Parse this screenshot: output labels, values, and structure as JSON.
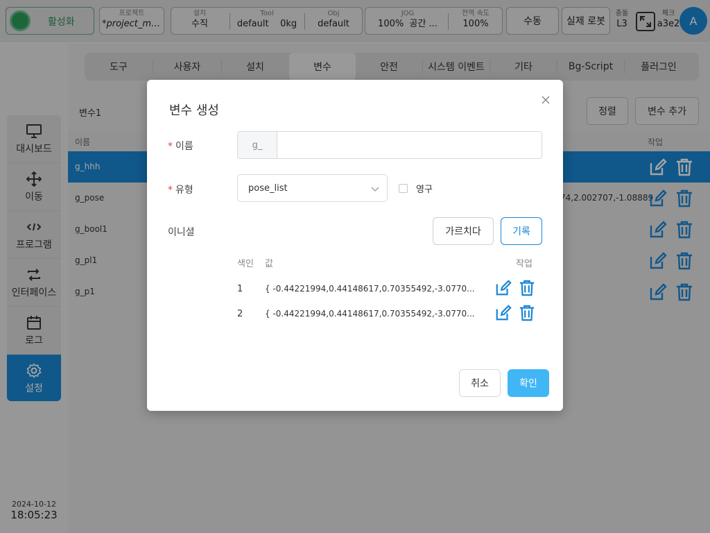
{
  "topbar": {
    "activate_label": "활성화",
    "project": {
      "label": "프로젝트",
      "value": "*project_mo..."
    },
    "install": {
      "label": "설치",
      "value": "수직"
    },
    "tool": {
      "label": "Tool",
      "value1": "default",
      "value2": "0kg"
    },
    "obj": {
      "label": "Obj",
      "value": "default"
    },
    "jog": {
      "label": "JOG",
      "value1": "100%",
      "value2": "공간 ..."
    },
    "speed": {
      "label": "전역 속도",
      "value": "100%"
    },
    "manual_label": "수동",
    "real_robot_label": "실제 로봇",
    "collision": {
      "label": "충돌",
      "value": "L3"
    },
    "check": {
      "label": "체크",
      "value": "a3e2"
    },
    "avatar_letter": "A"
  },
  "sidebar": {
    "items": [
      {
        "label": "대시보드",
        "icon": "monitor-icon"
      },
      {
        "label": "이동",
        "icon": "move-icon"
      },
      {
        "label": "프로그램",
        "icon": "code-icon"
      },
      {
        "label": "인터페이스",
        "icon": "swap-icon"
      },
      {
        "label": "로그",
        "icon": "calendar-icon"
      },
      {
        "label": "설정",
        "icon": "gear-icon"
      }
    ],
    "active_index": 5,
    "date": "2024-10-12",
    "time": "18:05:23"
  },
  "tabs": [
    "도구",
    "사용자",
    "설치",
    "변수",
    "안전",
    "시스템 이벤트",
    "기타",
    "Bg-Script",
    "플러그인"
  ],
  "active_tab": "변수",
  "varbar": {
    "title": "변수1",
    "sort_label": "정렬",
    "add_label": "변수 추가"
  },
  "table": {
    "headers": {
      "name": "이름",
      "action": "작업"
    },
    "rows": [
      {
        "name": "g_hhh",
        "value": "",
        "selected": true
      },
      {
        "name": "g_pose",
        "value": "74,2.002707,-1.08889",
        "selected": false
      },
      {
        "name": "g_bool1",
        "value": "",
        "selected": false
      },
      {
        "name": "g_pl1",
        "value": "",
        "selected": false
      },
      {
        "name": "g_p1",
        "value": "",
        "selected": false
      }
    ]
  },
  "modal": {
    "title": "변수 생성",
    "required_mark": "*",
    "name_label": "이름",
    "name_prefix": "g_",
    "name_value": "",
    "type_label": "유형",
    "type_value": "pose_list",
    "persist_label": "영구",
    "initial_label": "이니셜",
    "teach_label": "가르치다",
    "record_label": "기록",
    "sub_headers": {
      "index": "색인",
      "value": "값",
      "action": "작업"
    },
    "sub_rows": [
      {
        "index": "1",
        "value": "{ -0.44221994,0.44148617,0.70355492,-3.0770..."
      },
      {
        "index": "2",
        "value": "{ -0.44221994,0.44148617,0.70355492,-3.0770..."
      }
    ],
    "cancel_label": "취소",
    "ok_label": "확인"
  },
  "colors": {
    "accent": "#1a86d4",
    "ok": "#41b6f5",
    "active_green": "#2c9e59",
    "required": "#e0443c"
  }
}
